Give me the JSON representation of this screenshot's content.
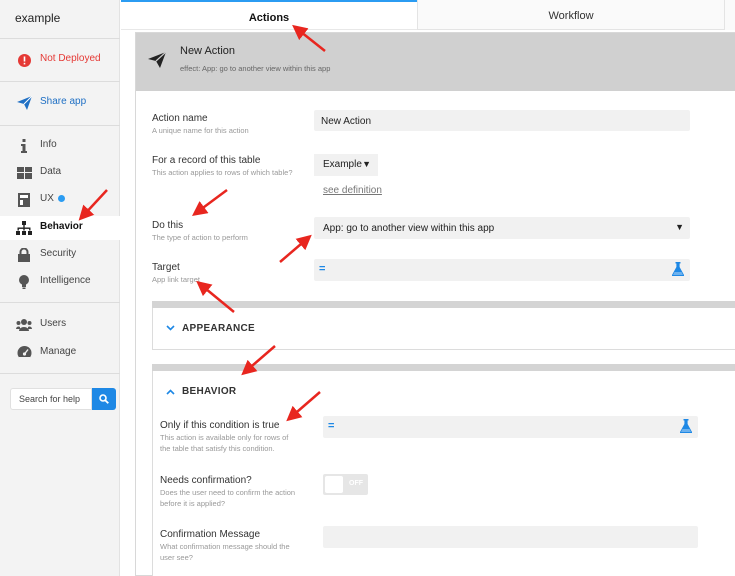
{
  "app": {
    "name": "example"
  },
  "sidebar": {
    "status": "Not Deployed",
    "share": "Share app",
    "items": [
      {
        "label": "Info",
        "icon": "info-icon"
      },
      {
        "label": "Data",
        "icon": "table-icon"
      },
      {
        "label": "UX",
        "icon": "ux-icon"
      },
      {
        "label": "Behavior",
        "icon": "hierarchy-icon",
        "active": true
      },
      {
        "label": "Security",
        "icon": "lock-icon"
      },
      {
        "label": "Intelligence",
        "icon": "bulb-icon"
      },
      {
        "label": "Users",
        "icon": "users-icon"
      },
      {
        "label": "Manage",
        "icon": "dashboard-icon"
      }
    ],
    "search_placeholder": "Search for help"
  },
  "tabs": {
    "actions": "Actions",
    "workflow": "Workflow"
  },
  "action": {
    "title": "New Action",
    "effect": "effect: App: go to another view within this app"
  },
  "form": {
    "name_label": "Action name",
    "name_help": "A unique name for this action",
    "name_value": "New Action",
    "table_label": "For a record of this table",
    "table_help": "This action applies to rows of which table?",
    "table_value": "Example",
    "see_definition": "see definition",
    "do_label": "Do this",
    "do_help": "The type of action to perform",
    "do_value": "App: go to another view within this app",
    "target_label": "Target",
    "target_help": "App link target",
    "eq": "="
  },
  "appearance": {
    "title": "APPEARANCE"
  },
  "behavior": {
    "title": "BEHAVIOR",
    "condition_label": "Only if this condition is true",
    "condition_help1": "This action is available only for rows of",
    "condition_help2": "the table that satisfy this condition.",
    "confirm_label": "Needs confirmation?",
    "confirm_help1": "Does the user need to confirm the action",
    "confirm_help2": "before it is applied?",
    "toggle_text": "OFF",
    "message_label": "Confirmation Message",
    "message_help1": "What confirmation message should the",
    "message_help2": "user see?"
  },
  "colors": {
    "accent": "#1e88e5",
    "error": "#e53935",
    "arrow": "#e8261f"
  }
}
